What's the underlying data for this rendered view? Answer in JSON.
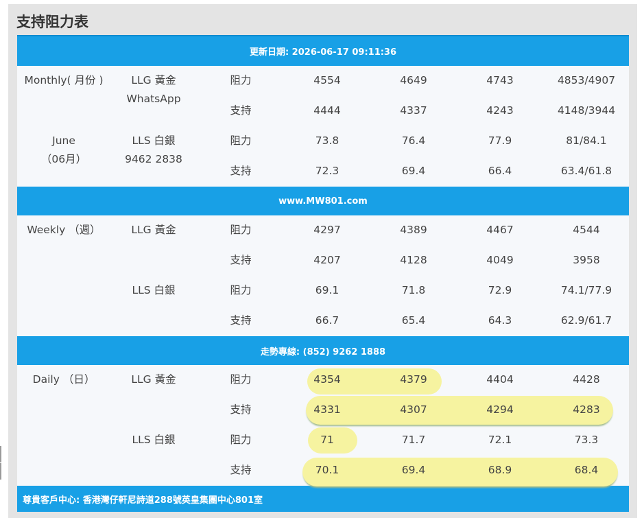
{
  "title": "支持阻力表",
  "updated": "更新日期: 2026-06-17 09:11:36",
  "website": "www.MW801.com",
  "hotline": "走勢專線: (852) 9262 1888",
  "footer": "尊貴客戶中心: 香港灣仔軒尼詩道288號英皇集團中心801室",
  "monthly": {
    "period_label": "Monthly( 月份 )",
    "month": "June",
    "month_cn": "（06月）",
    "gold_label": "LLG 黃金",
    "gold_sub": "WhatsApp",
    "silver_label": "LLS 白銀",
    "silver_sub": "9462 2838",
    "rows": [
      {
        "type": "阻力",
        "values": [
          "4554",
          "4649",
          "4743",
          "4853/4907"
        ]
      },
      {
        "type": "支持",
        "values": [
          "4444",
          "4337",
          "4243",
          "4148/3944"
        ]
      },
      {
        "type": "阻力",
        "values": [
          "73.8",
          "76.4",
          "77.9",
          "81/84.1"
        ]
      },
      {
        "type": "支持",
        "values": [
          "72.3",
          "69.4",
          "66.4",
          "63.4/61.8"
        ]
      }
    ]
  },
  "weekly": {
    "period_label": "Weekly （週）",
    "gold_label": "LLG 黃金",
    "silver_label": "LLS 白銀",
    "rows": [
      {
        "type": "阻力",
        "values": [
          "4297",
          "4389",
          "4467",
          "4544"
        ]
      },
      {
        "type": "支持",
        "values": [
          "4207",
          "4128",
          "4049",
          "3958"
        ]
      },
      {
        "type": "阻力",
        "values": [
          "69.1",
          "71.8",
          "72.9",
          "74.1/77.9"
        ]
      },
      {
        "type": "支持",
        "values": [
          "66.7",
          "65.4",
          "64.3",
          "62.9/61.7"
        ]
      }
    ]
  },
  "daily": {
    "period_label": "Daily （日）",
    "gold_label": "LLG 黃金",
    "silver_label": "LLS 白銀",
    "rows": [
      {
        "type": "阻力",
        "values": [
          "4354",
          "4379",
          "4404",
          "4428"
        ]
      },
      {
        "type": "支持",
        "values": [
          "4331",
          "4307",
          "4294",
          "4283"
        ]
      },
      {
        "type": "阻力",
        "values": [
          "71",
          "71.7",
          "72.1",
          "73.3"
        ]
      },
      {
        "type": "支持",
        "values": [
          "70.1",
          "69.4",
          "68.9",
          "68.4"
        ]
      }
    ]
  },
  "highlight_color": "#f6f3a0",
  "bar_color": "#18a0e6"
}
